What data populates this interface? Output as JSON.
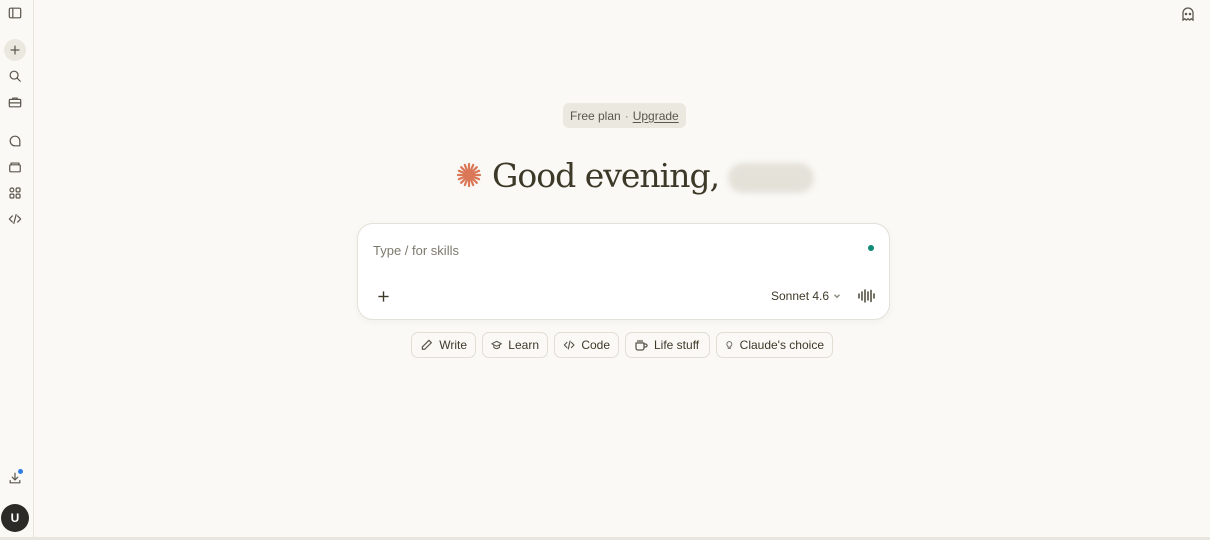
{
  "sidebar": {
    "items": [
      {
        "icon": "sidebar-toggle-icon"
      },
      {
        "icon": "plus-icon"
      },
      {
        "icon": "search-icon"
      },
      {
        "icon": "toolbox-icon"
      },
      {
        "icon": "chat-bubble-icon"
      },
      {
        "icon": "archive-box-icon"
      },
      {
        "icon": "apps-grid-icon"
      },
      {
        "icon": "code-icon"
      },
      {
        "icon": "download-icon"
      }
    ],
    "avatar_initial": "U"
  },
  "header": {
    "ghost_icon": "incognito-icon"
  },
  "plan": {
    "label": "Free plan",
    "separator": "·",
    "upgrade_label": "Upgrade"
  },
  "greeting": {
    "text": "Good evening,",
    "accent_color": "#d97757"
  },
  "composer": {
    "placeholder": "Type / for skills",
    "value": "",
    "model_label": "Sonnet 4.6",
    "status_color": "#0f8a74"
  },
  "chips": [
    {
      "label": "Write",
      "icon": "pencil-icon"
    },
    {
      "label": "Learn",
      "icon": "graduation-cap-icon"
    },
    {
      "label": "Code",
      "icon": "code-icon"
    },
    {
      "label": "Life stuff",
      "icon": "coffee-cup-icon"
    },
    {
      "label": "Claude's choice",
      "icon": "lightbulb-icon"
    }
  ]
}
